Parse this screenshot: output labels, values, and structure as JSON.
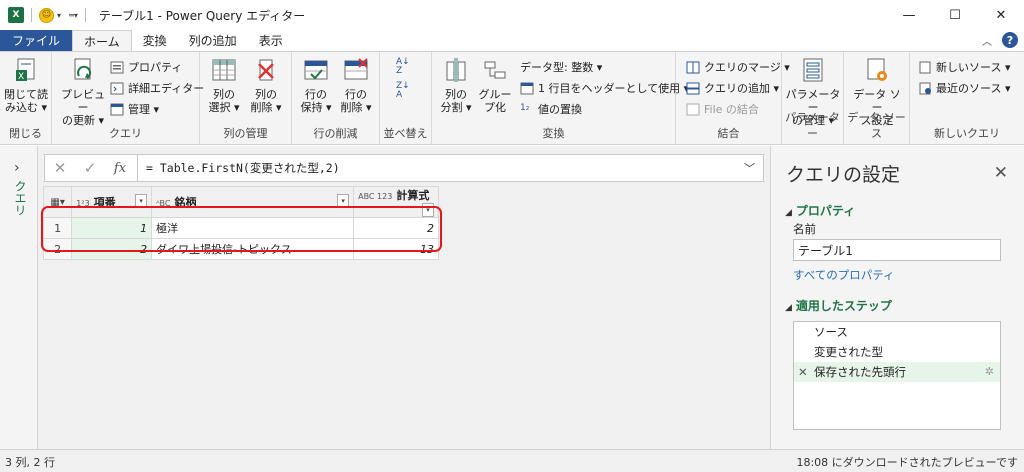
{
  "window": {
    "title": "テーブル1 - Power Query エディター",
    "app_icon": "X",
    "buttons": [
      "—",
      "☐",
      "✕"
    ]
  },
  "tabs": [
    {
      "label": "ファイル"
    },
    {
      "label": "ホーム"
    },
    {
      "label": "変換"
    },
    {
      "label": "列の追加"
    },
    {
      "label": "表示"
    }
  ],
  "ribbon": {
    "close": {
      "btn1": "閉じて読",
      "btn1b": "み込む ▾",
      "label": "閉じる"
    },
    "query": {
      "preview": "プレビュー",
      "preview2": "の更新 ▾",
      "properties": "プロパティ",
      "adv_editor": "詳細エディター",
      "manage": "管理 ▾",
      "label": "クエリ"
    },
    "columns": {
      "select1": "列の",
      "select2": "選択 ▾",
      "delete1": "列の",
      "delete2": "削除 ▾",
      "label": "列の管理"
    },
    "rows": {
      "keep1": "行の",
      "keep2": "保持 ▾",
      "delete1": "行の",
      "delete2": "削除 ▾",
      "label": "行の削減"
    },
    "sort": {
      "label": "並べ替え"
    },
    "transform": {
      "split1": "列の",
      "split2": "分割 ▾",
      "group1": "グルー",
      "group2": "プ化",
      "datatype": "データ型: 整数 ▾",
      "header": "1 行目をヘッダーとして使用 ▾",
      "replace": "値の置換",
      "label": "変換"
    },
    "combine": {
      "merge": "クエリのマージ ▾",
      "append": "クエリの追加 ▾",
      "file": "File の結合",
      "label": "結合"
    },
    "params": {
      "btn1": "パラメーター",
      "btn2": "の管理 ▾",
      "label": "パラメーター"
    },
    "datasource": {
      "btn1": "データ ソー",
      "btn2": "ス設定",
      "label": "データ ソース"
    },
    "newquery": {
      "new": "新しいソース ▾",
      "recent": "最近のソース ▾",
      "label": "新しいクエリ"
    }
  },
  "query_panel": {
    "label": "クエリ",
    "chevron": "›"
  },
  "formula": {
    "text": "= Table.FirstN(変更された型,2)",
    "cancel": "✕",
    "confirm": "✓",
    "fx": "fx"
  },
  "table": {
    "headers": [
      {
        "type": "1²3",
        "name": "項番"
      },
      {
        "type": "ᴬBC",
        "name": "銘柄"
      },
      {
        "type": "ABC 123",
        "name": "計算式"
      }
    ],
    "rows": [
      {
        "n": "1",
        "c1": "1",
        "c2": "極洋",
        "c3": "2"
      },
      {
        "n": "2",
        "c1": "2",
        "c2": "ダイワ上場投信-トピックス",
        "c3": "13"
      }
    ],
    "highlight_color": "#e0191d"
  },
  "settings": {
    "title": "クエリの設定",
    "properties_header": "プロパティ",
    "name_label": "名前",
    "name_value": "テーブル1",
    "all_props_link": "すべてのプロパティ",
    "steps_header": "適用したステップ",
    "steps": [
      "ソース",
      "変更された型",
      "保存された先頭行"
    ]
  },
  "status": {
    "left": "3 列, 2 行",
    "right": "18:08 にダウンロードされたプレビューです"
  }
}
